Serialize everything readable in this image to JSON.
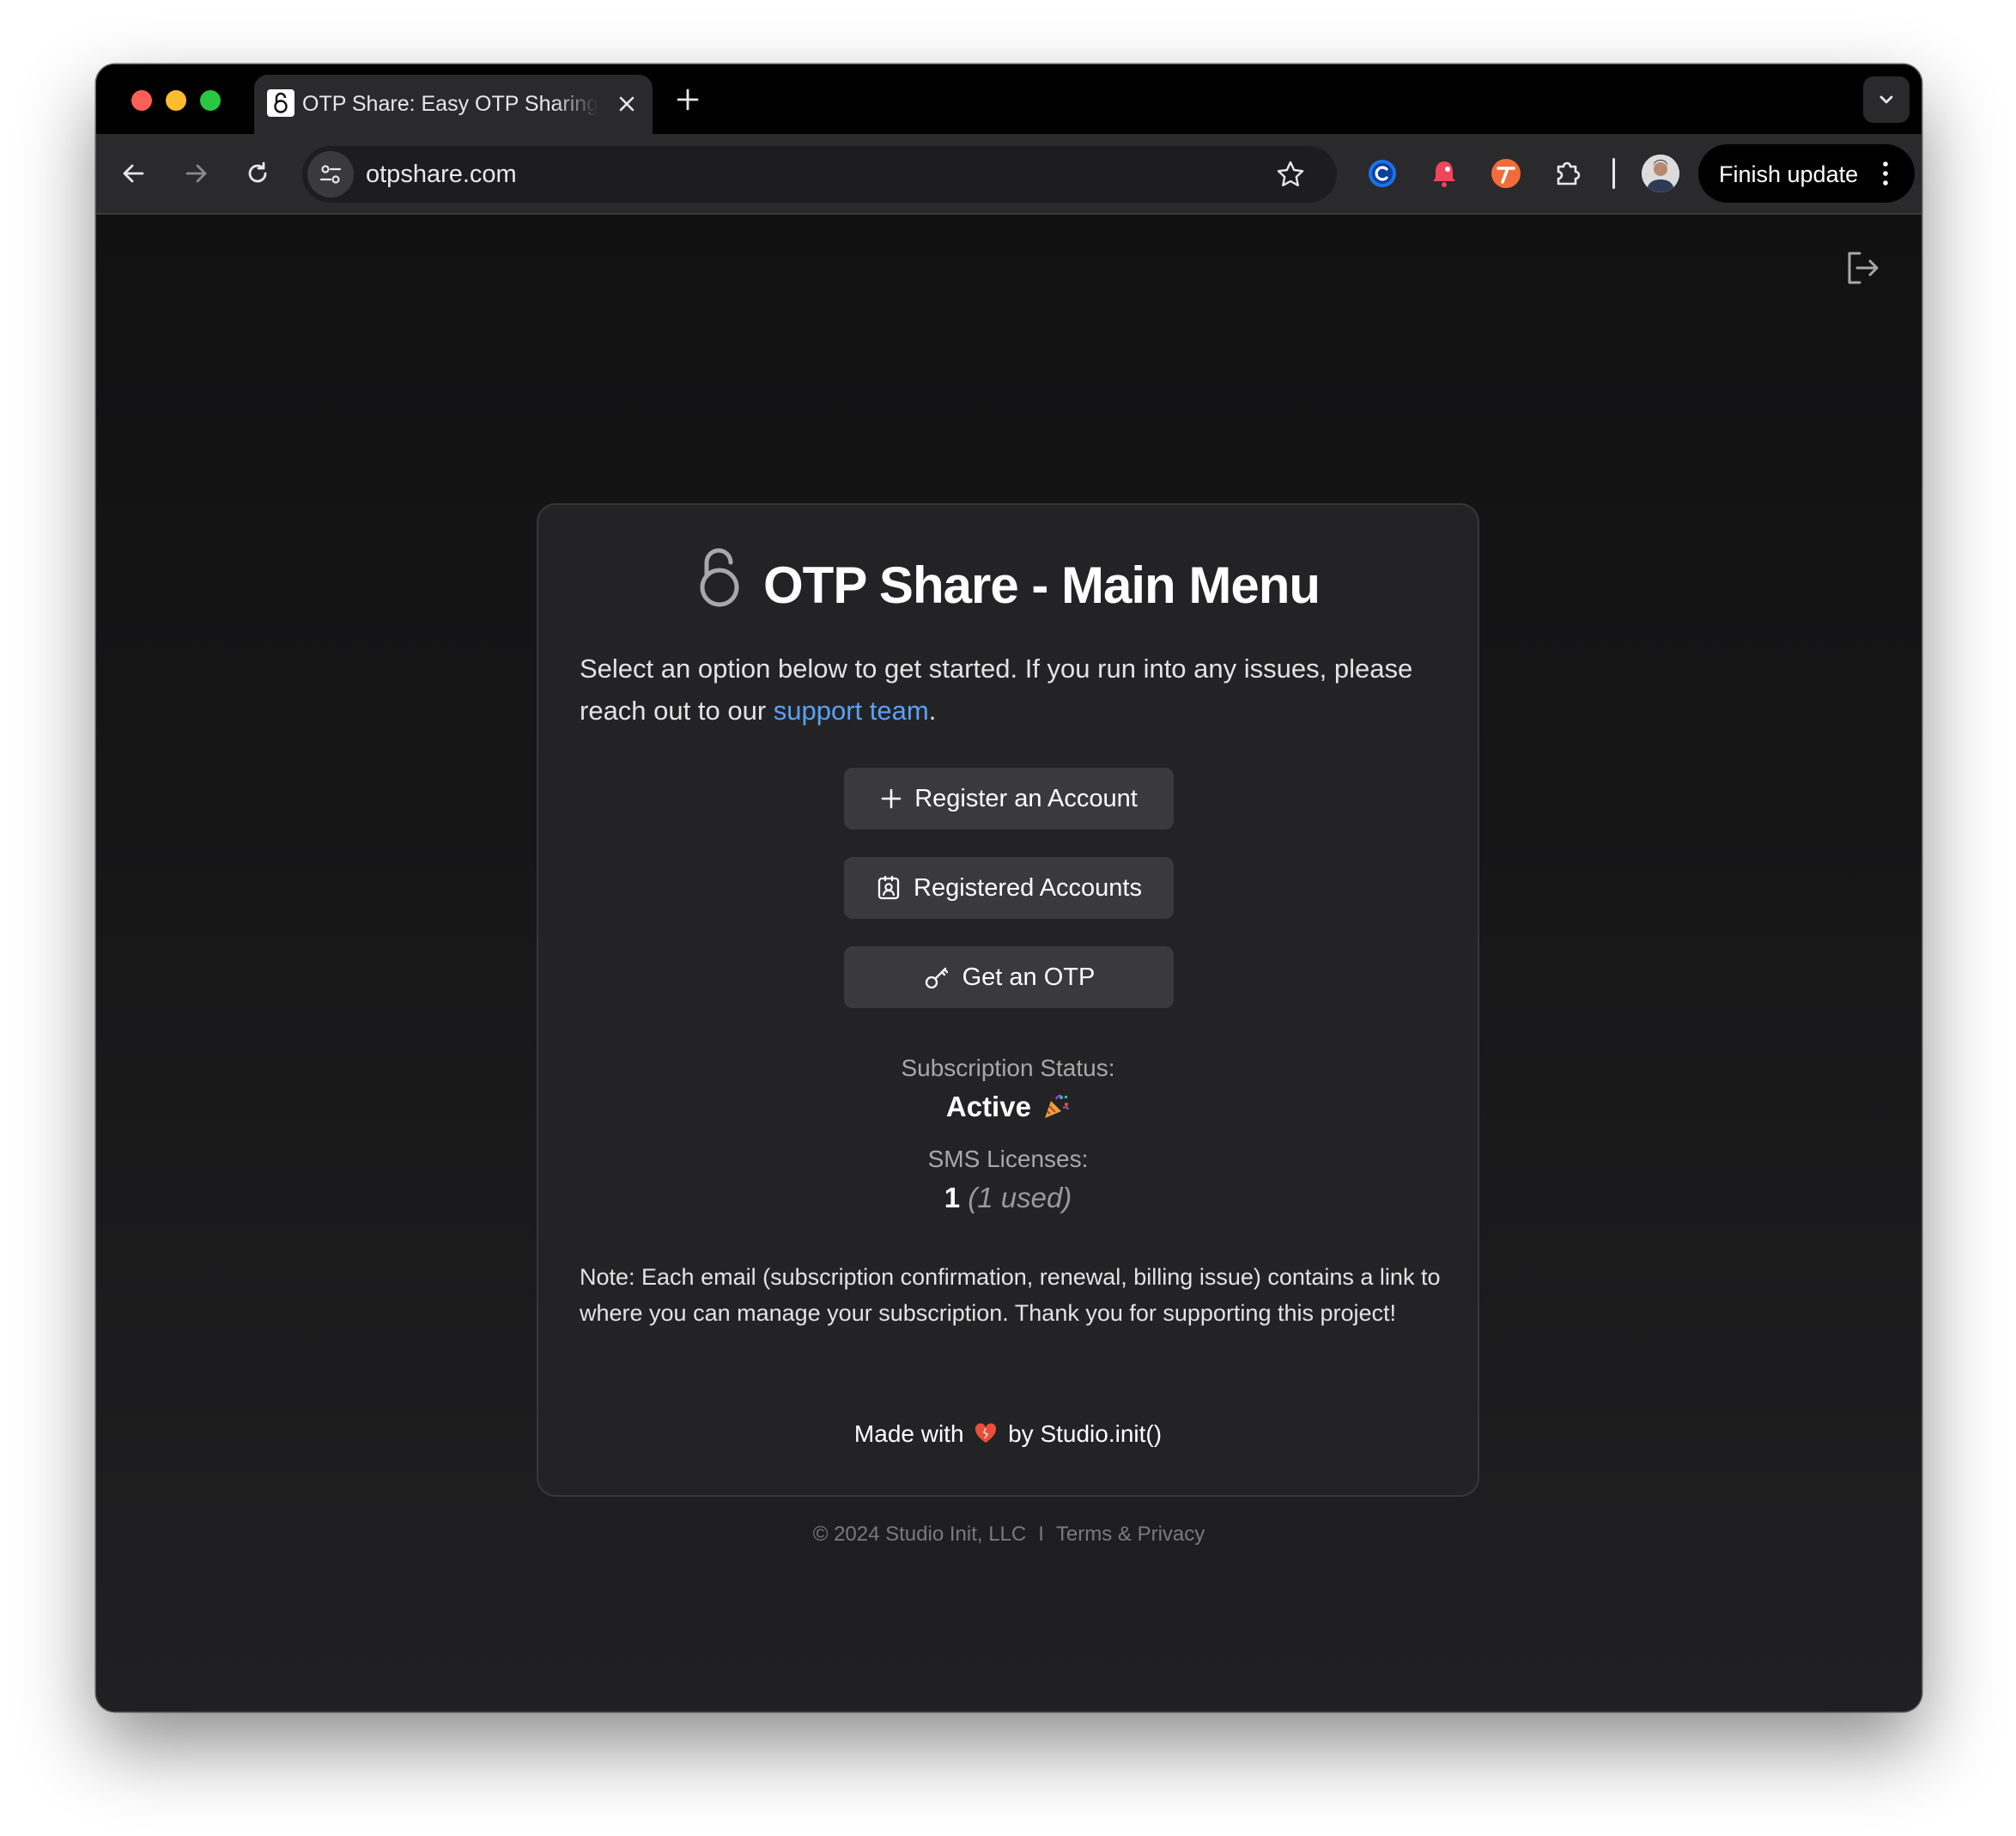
{
  "browser": {
    "tab_title": "OTP Share: Easy OTP Sharing",
    "url": "otpshare.com",
    "update_button_label": "Finish update"
  },
  "card": {
    "title": "OTP Share - Main Menu",
    "intro_text": "Select an option below to get started. If you run into any issues, please reach out to our ",
    "intro_link": "support team",
    "intro_end": ".",
    "buttons": {
      "register": "Register an Account",
      "registered": "Registered Accounts",
      "get_otp": "Get an OTP"
    },
    "subscription": {
      "label": "Subscription Status:",
      "value": "Active"
    },
    "sms": {
      "label": "SMS Licenses:",
      "count": "1",
      "used": "(1 used)"
    },
    "note": "Note: Each email (subscription confirmation, renewal, billing issue) contains a link to where you can manage your subscription. Thank you for supporting this project!",
    "made_prefix": "Made with",
    "made_suffix": "by Studio.init()"
  },
  "footer": {
    "copyright": "© 2024 Studio Init, LLC",
    "separator": "I",
    "link": "Terms & Privacy"
  },
  "icons": {
    "tab_favicon": "lock-icon",
    "tab_close": "close-icon",
    "new_tab": "plus-icon",
    "tab_search": "chevron-down-icon",
    "back": "arrow-left-icon",
    "forward": "arrow-right-icon",
    "reload": "reload-icon",
    "site_info": "tune-icon",
    "bookmark": "star-icon",
    "logout": "logout-icon",
    "title": "lock-icon",
    "register": "plus-icon",
    "registered": "contact-icon",
    "otp": "key-icon",
    "party": "party-popper-icon",
    "heart": "heart-icon"
  },
  "colors": {
    "link": "#5aa1f7",
    "card_bg": "#232325",
    "button_bg": "#3a3a3d",
    "page_bg": "#202022"
  }
}
